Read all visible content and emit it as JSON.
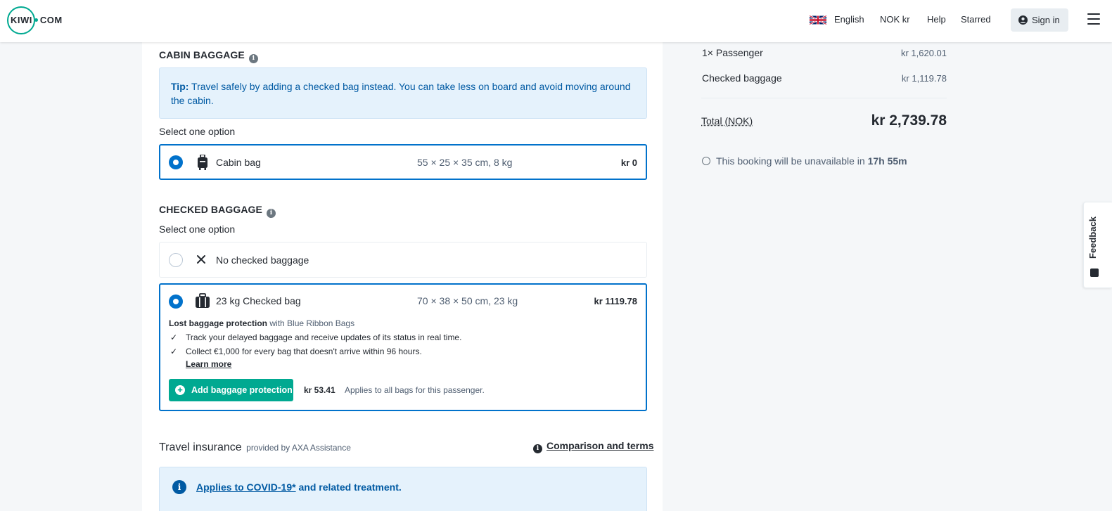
{
  "header": {
    "logo": "KIWI · COM",
    "logo_left": "KIWI",
    "logo_right": "COM",
    "language": "English",
    "currency": "NOK kr",
    "help": "Help",
    "starred": "Starred",
    "sign_in": "Sign in"
  },
  "cabin": {
    "title": "CABIN BAGGAGE",
    "tip_label": "Tip:",
    "tip_text": " Travel safely by adding a checked bag instead. You can take less on board and avoid moving around the cabin.",
    "select_label": "Select one option",
    "option": {
      "name": "Cabin bag",
      "dims": "55 × 25 × 35 cm, 8 kg",
      "price": "kr 0",
      "selected": true
    }
  },
  "checked": {
    "title": "CHECKED BAGGAGE",
    "select_label": "Select one option",
    "options": [
      {
        "name": "No checked baggage",
        "selected": false
      },
      {
        "name": "23 kg Checked bag",
        "dims": "70 × 38 × 50 cm, 23 kg",
        "price": "kr 1119.78",
        "selected": true
      }
    ],
    "protection": {
      "title": "Lost baggage protection",
      "provider": "with Blue Ribbon Bags",
      "benefits": [
        "Track your delayed baggage and receive updates of its status in real time.",
        "Collect €1,000 for every bag that doesn't arrive within 96 hours."
      ],
      "learn_more": "Learn more",
      "add_button": "Add baggage protection",
      "price": "kr 53.41",
      "note": "Applies to all bags for this passenger."
    }
  },
  "insurance": {
    "title": "Travel insurance",
    "provider": "provided by AXA Assistance",
    "comparison": "Comparison and terms",
    "covid_link": "Applies to COVID-19*",
    "covid_rest": " and related treatment."
  },
  "summary": {
    "rows": [
      {
        "label": "1× Passenger",
        "value": "kr 1,620.01"
      },
      {
        "label": "Checked baggage",
        "value": "kr 1,119.78"
      }
    ],
    "total_label": "Total (NOK)",
    "total_value": "kr 2,739.78",
    "timer_text": "This booking will be unavailable in ",
    "timer_value": "17h 55m"
  },
  "feedback": "Feedback",
  "colors": {
    "brand": "#00a991",
    "primary_blue": "#0172cb",
    "tip_bg": "#e5f2fc",
    "tip_text": "#005aa3"
  }
}
